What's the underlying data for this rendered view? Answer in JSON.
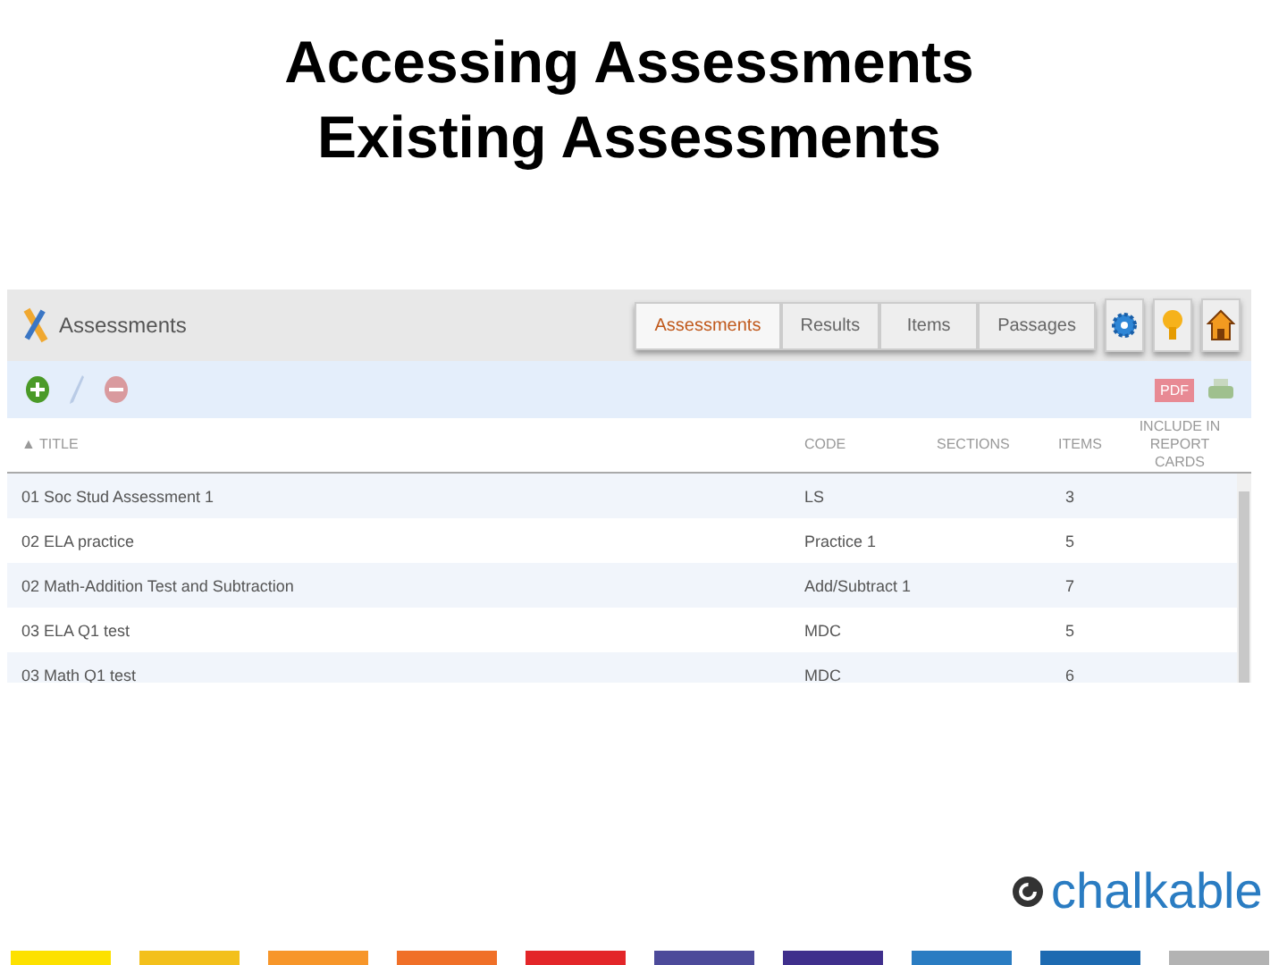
{
  "slide_title": [
    "Accessing Assessments",
    "Existing Assessments"
  ],
  "app": {
    "title": "Assessments",
    "tabs": [
      {
        "label": "Assessments",
        "selected": true
      },
      {
        "label": "Results",
        "selected": false
      },
      {
        "label": "Items",
        "selected": false
      },
      {
        "label": "Passages",
        "selected": false
      }
    ],
    "pdf_label": "PDF",
    "table": {
      "sort_mark": "▲",
      "columns": [
        "TITLE",
        "CODE",
        "SECTIONS",
        "ITEMS",
        "INCLUDE IN REPORT CARDS"
      ],
      "rows": [
        {
          "title": "01 Soc Stud Assessment 1",
          "code": "LS",
          "items": "3"
        },
        {
          "title": "02 ELA practice",
          "code": "Practice 1",
          "items": "5"
        },
        {
          "title": "02 Math-Addition Test and Subtraction",
          "code": "Add/Subtract 1",
          "items": "7"
        },
        {
          "title": "03 ELA Q1 test",
          "code": "MDC",
          "items": "5"
        },
        {
          "title": "03 Math Q1 test",
          "code": "MDC",
          "items": "6"
        }
      ]
    }
  },
  "logo": "chalkable",
  "color_bars": [
    {
      "color": "#fde100"
    },
    {
      "color": "#f3c01c"
    },
    {
      "color": "#f7962a"
    },
    {
      "color": "#f07028"
    },
    {
      "color": "#e32629"
    },
    {
      "color": "#4c4a9a"
    },
    {
      "color": "#3f2f8c"
    },
    {
      "color": "#2a7cc2"
    },
    {
      "color": "#1d6ab1"
    },
    {
      "color": "#b3b3b3"
    }
  ]
}
